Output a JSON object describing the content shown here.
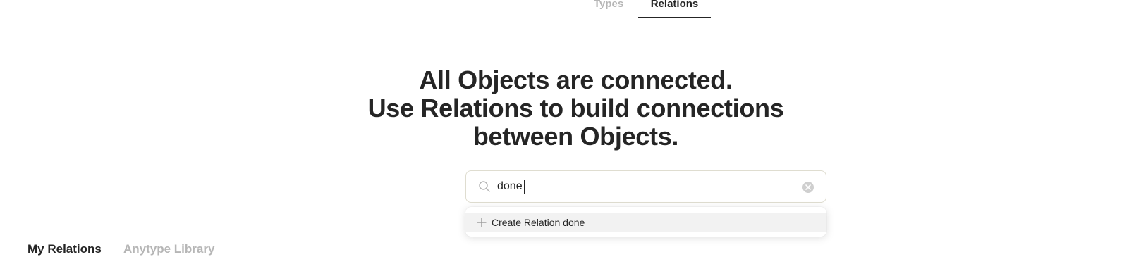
{
  "top_tabs": {
    "types": "Types",
    "relations": "Relations",
    "active": "Relations"
  },
  "headline": {
    "line1": "All Objects are connected.",
    "line2": "Use Relations to build connections",
    "line3": "between Objects."
  },
  "search": {
    "value": "done",
    "icon": "search-icon",
    "clear_icon": "clear-icon"
  },
  "dropdown": {
    "items": [
      {
        "icon": "plus-icon",
        "label": "Create Relation done"
      }
    ]
  },
  "bottom_tabs": {
    "mine": "My Relations",
    "library": "Anytype Library",
    "active": "My Relations"
  },
  "colors": {
    "text": "#252525",
    "muted": "#b6b6b6",
    "border": "#dfddd0",
    "highlight": "#f2f2f2"
  }
}
